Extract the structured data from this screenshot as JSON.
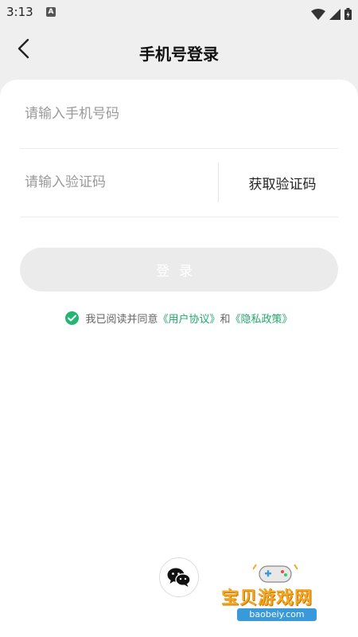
{
  "status_bar": {
    "time": "3:13",
    "notification_icon_letter": "A",
    "icons": [
      "wifi-icon",
      "signal-icon",
      "battery-icon"
    ]
  },
  "header": {
    "back_icon": "chevron-left-icon",
    "title": "手机号登录"
  },
  "form": {
    "phone_placeholder": "请输入手机号码",
    "code_placeholder": "请输入验证码",
    "get_code_label": "获取验证码",
    "login_label": "登录"
  },
  "agreement": {
    "checked": true,
    "prefix": "我已阅读并同意",
    "user_agreement": "《用户协议》",
    "connector": "和",
    "privacy_policy": "《隐私政策》"
  },
  "third_party": {
    "wechat_icon": "wechat-icon"
  },
  "watermark": {
    "title": "宝贝游戏网",
    "url": "baobeiy.com"
  },
  "colors": {
    "accent": "#22b573",
    "link": "#22a86b",
    "background": "#efefef",
    "card": "#ffffff",
    "disabled_button": "#ebebeb"
  }
}
